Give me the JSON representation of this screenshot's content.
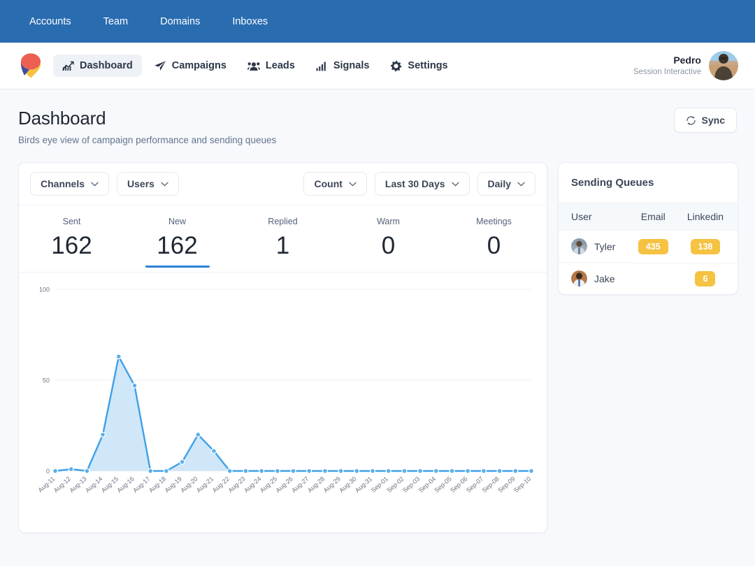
{
  "topnav": {
    "items": [
      {
        "label": "Accounts",
        "name": "accounts"
      },
      {
        "label": "Team",
        "name": "team"
      },
      {
        "label": "Domains",
        "name": "domains"
      },
      {
        "label": "Inboxes",
        "name": "inboxes"
      }
    ],
    "background": "#2a6cb0"
  },
  "mainnav": {
    "logo_icon": "pin-logo-icon",
    "items": [
      {
        "label": "Dashboard",
        "icon": "chart-line-up-icon",
        "active": true
      },
      {
        "label": "Campaigns",
        "icon": "paper-plane-icon",
        "active": false
      },
      {
        "label": "Leads",
        "icon": "people-group-icon",
        "active": false
      },
      {
        "label": "Signals",
        "icon": "signal-bars-icon",
        "active": false
      },
      {
        "label": "Settings",
        "icon": "gear-icon",
        "active": false
      }
    ],
    "user": {
      "name": "Pedro",
      "org": "Session Interactive",
      "avatar_icon": "user-photo-avatar"
    }
  },
  "header": {
    "title": "Dashboard",
    "subtitle": "Birds eye view of campaign performance and sending queues",
    "sync_label": "Sync",
    "sync_icon": "refresh-icon"
  },
  "filters": {
    "left": [
      {
        "label": "Channels",
        "icon": "chevron-down-icon"
      },
      {
        "label": "Users",
        "icon": "chevron-down-icon"
      }
    ],
    "right": [
      {
        "label": "Count",
        "icon": "chevron-down-icon"
      },
      {
        "label": "Last 30 Days",
        "icon": "chevron-down-icon"
      },
      {
        "label": "Daily",
        "icon": "chevron-down-icon"
      }
    ]
  },
  "stats": [
    {
      "label": "Sent",
      "value": "162",
      "active": false
    },
    {
      "label": "New",
      "value": "162",
      "active": true
    },
    {
      "label": "Replied",
      "value": "1",
      "active": false
    },
    {
      "label": "Warm",
      "value": "0",
      "active": false
    },
    {
      "label": "Meetings",
      "value": "0",
      "active": false
    }
  ],
  "sending_queues": {
    "title": "Sending Queues",
    "columns": [
      "User",
      "Email",
      "Linkedin"
    ],
    "rows": [
      {
        "user": "Tyler",
        "email": "435",
        "linkedin": "138",
        "avatar_icon": "user-photo-avatar"
      },
      {
        "user": "Jake",
        "email": "",
        "linkedin": "6",
        "avatar_icon": "user-photo-avatar"
      }
    ],
    "badge_color": "#f5c242"
  },
  "chart_data": {
    "type": "area",
    "title": "",
    "xlabel": "",
    "ylabel": "",
    "ylim": [
      0,
      100
    ],
    "yticks": [
      0,
      50,
      100
    ],
    "grid": true,
    "legend": false,
    "line_color": "#3fa0e8",
    "fill_color": "#cfe7f9",
    "categories": [
      "Aug-11",
      "Aug-12",
      "Aug-13",
      "Aug-14",
      "Aug-15",
      "Aug-16",
      "Aug-17",
      "Aug-18",
      "Aug-19",
      "Aug-20",
      "Aug-21",
      "Aug-22",
      "Aug-23",
      "Aug-24",
      "Aug-25",
      "Aug-26",
      "Aug-27",
      "Aug-28",
      "Aug-29",
      "Aug-30",
      "Aug-31",
      "Sep-01",
      "Sep-02",
      "Sep-03",
      "Sep-04",
      "Sep-05",
      "Sep-06",
      "Sep-07",
      "Sep-08",
      "Sep-09",
      "Sep-10"
    ],
    "series": [
      {
        "name": "New",
        "values": [
          0,
          1,
          0,
          20,
          63,
          47,
          0,
          0,
          5,
          20,
          11,
          0,
          0,
          0,
          0,
          0,
          0,
          0,
          0,
          0,
          0,
          0,
          0,
          0,
          0,
          0,
          0,
          0,
          0,
          0,
          0
        ]
      }
    ]
  }
}
